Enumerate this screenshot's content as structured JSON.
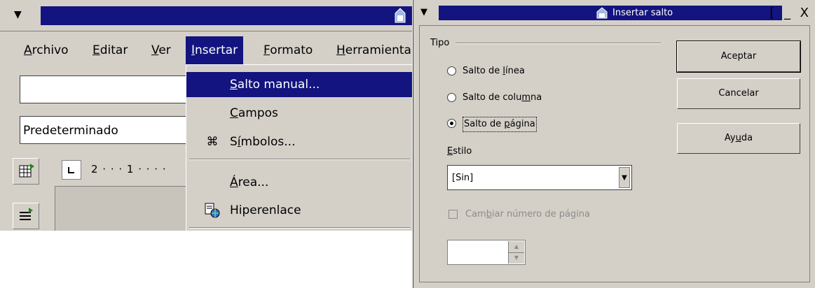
{
  "colors": {
    "titlebar": "#13147f",
    "face": "#d4d0c8",
    "highlight_text": "#ffffff",
    "disabled_text": "#8c8c8c"
  },
  "writer": {
    "window_menu_icon": "triangle-down-icon",
    "app_icon": "document-icon",
    "menubar": [
      {
        "label": "Archivo",
        "key": "A",
        "rest": "rchivo"
      },
      {
        "label": "Editar",
        "key": "E",
        "rest": "ditar"
      },
      {
        "label": "Ver",
        "key": "V",
        "rest": "er"
      },
      {
        "label": "Insertar",
        "key": "I",
        "rest": "nsertar"
      },
      {
        "label": "Formato",
        "key": "F",
        "rest": "ormato"
      },
      {
        "label": "Herramienta",
        "key": "H",
        "rest": "erramienta"
      }
    ],
    "field_top_value": "",
    "paragraph_style": "Predeterminado",
    "ruler_text": "2 · · · 1 · · · ·",
    "insert_menu": {
      "items": [
        {
          "label": "Salto manual...",
          "key": "S",
          "rest": "alto manual...",
          "icon": "",
          "highlighted": true
        },
        {
          "label": "Campos",
          "key": "C",
          "rest": "ampos",
          "icon": "",
          "highlighted": false
        },
        {
          "label": "Símbolos...",
          "pre": "S",
          "key": "í",
          "rest": "mbolos...",
          "icon": "command-icon",
          "glyph": "⌘",
          "highlighted": false
        },
        {
          "label": "Área...",
          "key": "Á",
          "rest": "rea...",
          "icon": "",
          "highlighted": false
        },
        {
          "label": "Hiperenlace",
          "key": "",
          "rest": "Hiperenlace",
          "icon": "hyperlink-icon",
          "highlighted": false
        }
      ]
    }
  },
  "dialog": {
    "title": "Insertar salto",
    "controls": "[ _ X",
    "tipo_label": "Tipo",
    "options": [
      {
        "pre": "Salto de ",
        "key": "l",
        "post": "ínea",
        "selected": false
      },
      {
        "pre": "Salto de colu",
        "key": "m",
        "post": "na",
        "selected": false
      },
      {
        "pre": "Salto de ",
        "key": "p",
        "post": "ágina",
        "selected": true
      }
    ],
    "estilo_label": {
      "pre": "",
      "key": "E",
      "post": "stilo"
    },
    "estilo_value": "[Sin]",
    "cambiar_label": {
      "pre": "Cam",
      "key": "b",
      "post": "iar número de página"
    },
    "cambiar_checked": false,
    "page_number_value": "",
    "buttons": {
      "accept": "Aceptar",
      "cancel": "Cancelar",
      "help": {
        "pre": "Ay",
        "key": "u",
        "post": "da"
      }
    }
  }
}
